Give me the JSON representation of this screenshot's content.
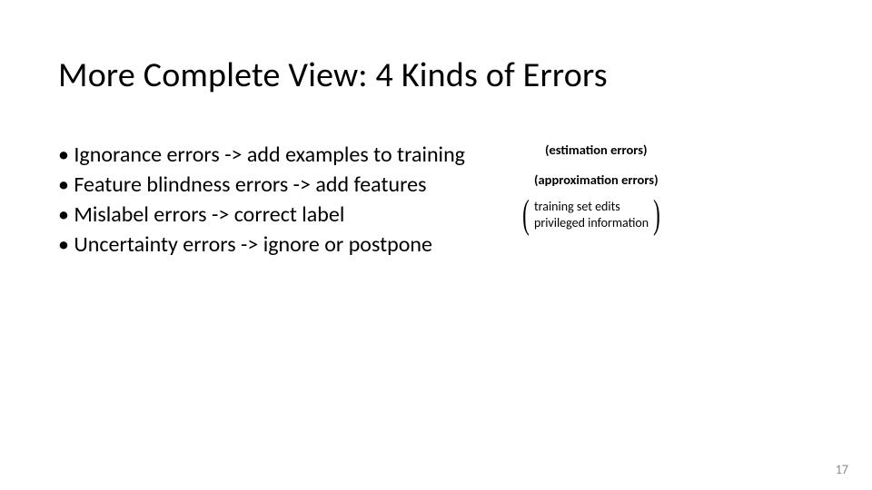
{
  "title": "More Complete View: 4 Kinds of Errors",
  "bullets": [
    "• Ignorance errors -> add examples to training",
    "• Feature blindness errors -> add features",
    "• Mislabel errors -> correct label",
    "• Uncertainty errors -> ignore or postpone"
  ],
  "right_notes": [
    "(estimation errors)",
    "(approximation errors)"
  ],
  "brace": {
    "top": "training set edits",
    "bottom": "privileged information"
  },
  "page_number": "17"
}
